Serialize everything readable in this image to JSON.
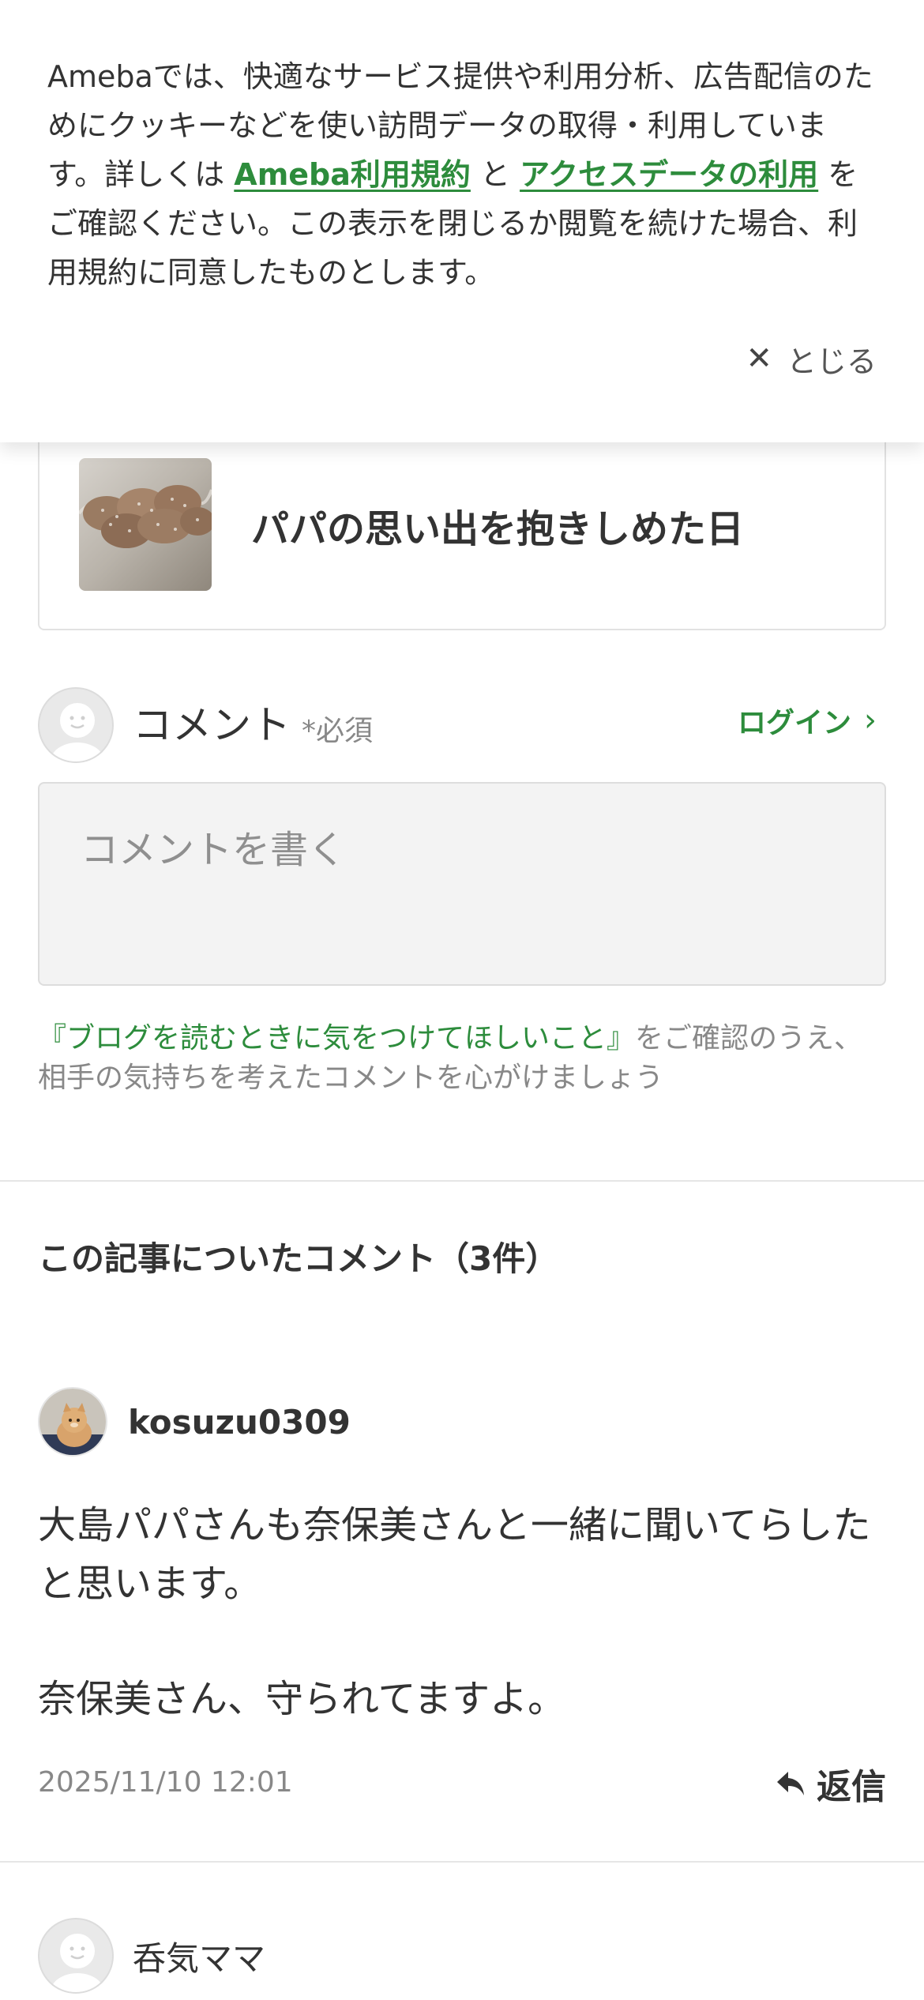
{
  "cookie_banner": {
    "text_before": "Amebaでは、快適なサービス提供や利用分析、広告配信のためにクッキーなどを使い訪問データの取得・利用しています。詳しくは ",
    "link1": "Ameba利用規約",
    "text_mid": " と ",
    "link2": "アクセスデータの利用",
    "text_after": " をご確認ください。この表示を閉じるか閲覧を続けた場合、利用規約に同意したものとします。",
    "close_label": "とじる",
    "close_icon": "close-icon"
  },
  "related_post": {
    "title": "パパの思い出を抱きしめた日",
    "thumb_icon": "bread-photo"
  },
  "comment_form": {
    "label": "コメント",
    "required": "*必須",
    "login": "ログイン",
    "placeholder": "コメントを書く",
    "notice_link": "『ブログを読むときに気をつけてほしいこと』",
    "notice_text": "をご確認のうえ、相手の気持ちを考えたコメントを心がけましょう"
  },
  "comments_section": {
    "title": "この記事についたコメント（3件）",
    "comments": [
      {
        "user": "kosuzu0309",
        "body_line1": "大島パパさんも奈保美さんと一緒に聞いてらしたと思います。",
        "body_line2": "奈保美さん、守られてますよ。",
        "date": "2025/11/10 12:01",
        "reply": "返信"
      },
      {
        "user": "呑気ママ"
      }
    ]
  },
  "colors": {
    "accent_green": "#2d8c3c",
    "text": "#333333",
    "muted": "#888888"
  }
}
